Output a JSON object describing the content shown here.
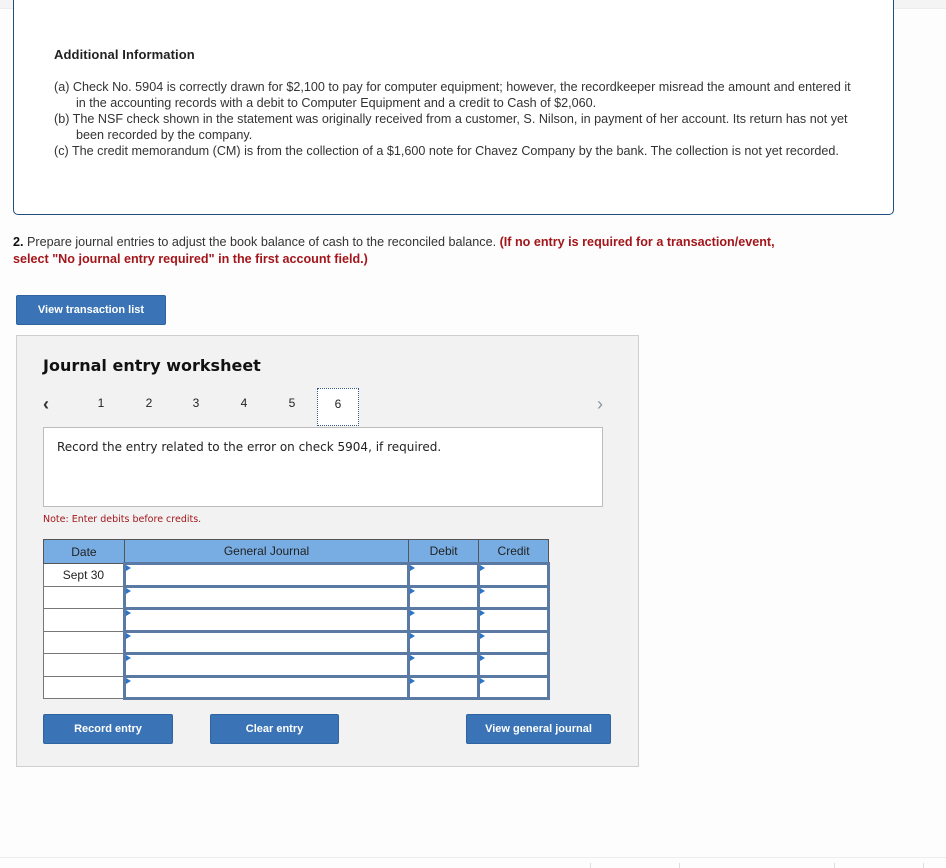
{
  "additional_info": {
    "title": "Additional Information",
    "items": [
      "(a) Check No. 5904 is correctly drawn for $2,100 to pay for computer equipment; however, the recordkeeper misread the amount and entered it in the accounting records with a debit to Computer Equipment and a credit to Cash of $2,060.",
      "(b) The NSF check shown in the statement was originally received from a customer, S. Nilson, in payment of her account. Its return has not yet been recorded by the company.",
      "(c) The credit memorandum (CM) is from the collection of a $1,600 note for Chavez Company by the bank. The collection is not yet recorded."
    ]
  },
  "question": {
    "number": "2.",
    "text": " Prepare journal entries to adjust the book balance of cash to the reconciled balance. ",
    "instruction": "(If no entry is required for a transaction/event, select \"No journal entry required\" in the first account field.)"
  },
  "buttons": {
    "view_transaction_list": "View transaction list",
    "record_entry": "Record entry",
    "clear_entry": "Clear entry",
    "view_general_journal": "View general journal"
  },
  "worksheet": {
    "title": "Journal entry worksheet",
    "prev_icon": "‹",
    "next_icon": "›",
    "tabs": [
      "1",
      "2",
      "3",
      "4",
      "5",
      "6"
    ],
    "active_tab": "6",
    "prompt": "Record the entry related to the error on check 5904, if required.",
    "note": "Note: Enter debits before credits.",
    "table": {
      "headers": [
        "Date",
        "General Journal",
        "Debit",
        "Credit"
      ],
      "rows": [
        {
          "date": "Sept 30",
          "account": "",
          "debit": "",
          "credit": ""
        },
        {
          "date": "",
          "account": "",
          "debit": "",
          "credit": ""
        },
        {
          "date": "",
          "account": "",
          "debit": "",
          "credit": ""
        },
        {
          "date": "",
          "account": "",
          "debit": "",
          "credit": ""
        },
        {
          "date": "",
          "account": "",
          "debit": "",
          "credit": ""
        },
        {
          "date": "",
          "account": "",
          "debit": "",
          "credit": ""
        }
      ]
    }
  }
}
